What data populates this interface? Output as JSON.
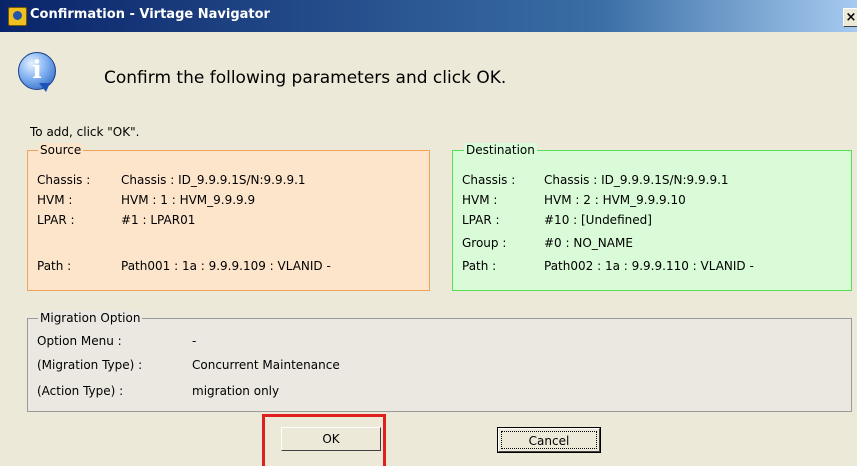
{
  "window": {
    "title": "Confirmation - Virtage Navigator",
    "close_label": "×"
  },
  "header": {
    "icon": "info-icon",
    "message": "Confirm the following parameters and click OK."
  },
  "instruction": "To add, click \"OK\".",
  "source": {
    "legend": "Source",
    "rows": [
      {
        "label": "Chassis :",
        "value": "Chassis : ID_9.9.9.1S/N:9.9.9.1"
      },
      {
        "label": "HVM :",
        "value": "HVM : 1 : HVM_9.9.9.9"
      },
      {
        "label": "LPAR :",
        "value": "#1 : LPAR01"
      },
      {
        "label": "Path :",
        "value": "Path001 : 1a : 9.9.9.109 : VLANID -"
      }
    ]
  },
  "destination": {
    "legend": "Destination",
    "rows": [
      {
        "label": "Chassis :",
        "value": "Chassis : ID_9.9.9.1S/N:9.9.9.1"
      },
      {
        "label": "HVM :",
        "value": "HVM : 2 : HVM_9.9.9.10"
      },
      {
        "label": "LPAR :",
        "value": "#10 : [Undefined]"
      },
      {
        "label": "Group :",
        "value": "#0 : NO_NAME"
      },
      {
        "label": "Path :",
        "value": "Path002 : 1a : 9.9.9.110 : VLANID -"
      }
    ]
  },
  "migration": {
    "legend": "Migration Option",
    "rows": [
      {
        "label": "Option Menu :",
        "value": "-"
      },
      {
        "label": "(Migration Type) :",
        "value": "Concurrent Maintenance"
      },
      {
        "label": "(Action Type) :",
        "value": "migration only"
      }
    ]
  },
  "buttons": {
    "ok": "OK",
    "cancel": "Cancel"
  },
  "colors": {
    "title_bar": "#0a246a",
    "source_fill": "#fde5cc",
    "source_border": "#f1a35a",
    "destination_fill": "#d9fbd7",
    "destination_border": "#55e055",
    "highlight": "#e0201e"
  }
}
